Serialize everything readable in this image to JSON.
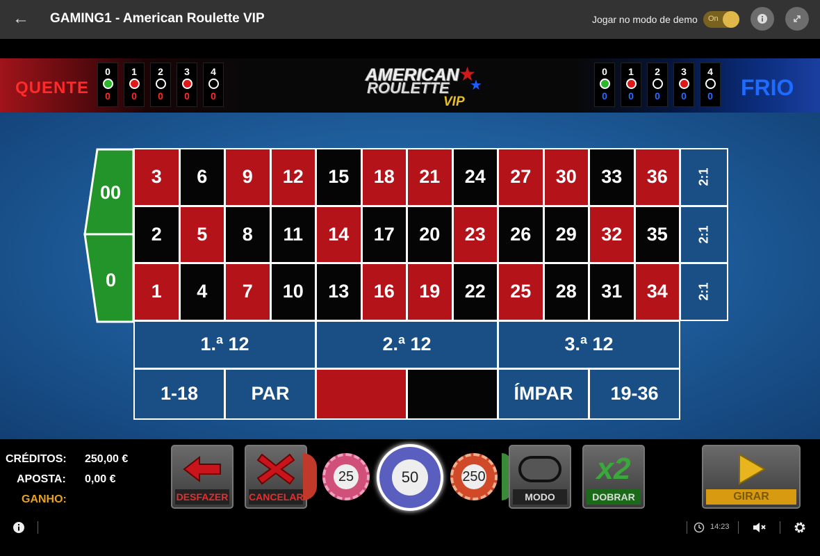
{
  "topbar": {
    "back_icon": "arrow-left-icon",
    "title": "GAMING1 - American Roulette VIP",
    "demo_label": "Jogar no modo de demo",
    "demo_toggle": "On",
    "info_icon": "info-icon",
    "fullscreen_icon": "expand-icon"
  },
  "banner": {
    "hot_label": "QUENTE",
    "cold_label": "FRIO",
    "hot_numbers": [
      {
        "num": "0",
        "color": "#2cb82c",
        "count": "0"
      },
      {
        "num": "1",
        "color": "#e01818",
        "count": "0"
      },
      {
        "num": "2",
        "color": "#000000",
        "count": "0"
      },
      {
        "num": "3",
        "color": "#e01818",
        "count": "0"
      },
      {
        "num": "4",
        "color": "#000000",
        "count": "0"
      }
    ],
    "cold_numbers": [
      {
        "num": "0",
        "color": "#2cb82c",
        "count": "0"
      },
      {
        "num": "1",
        "color": "#e01818",
        "count": "0"
      },
      {
        "num": "2",
        "color": "#000000",
        "count": "0"
      },
      {
        "num": "3",
        "color": "#e01818",
        "count": "0"
      },
      {
        "num": "4",
        "color": "#000000",
        "count": "0"
      }
    ],
    "logo": {
      "line1": "AMERICAN",
      "line2": "ROULETTE",
      "line3": "VIP"
    }
  },
  "table": {
    "zeros": [
      "00",
      "0"
    ],
    "rows": [
      [
        "3",
        "6",
        "9",
        "12",
        "15",
        "18",
        "21",
        "24",
        "27",
        "30",
        "33",
        "36"
      ],
      [
        "2",
        "5",
        "8",
        "11",
        "14",
        "17",
        "20",
        "23",
        "26",
        "29",
        "32",
        "35"
      ],
      [
        "1",
        "4",
        "7",
        "10",
        "13",
        "16",
        "19",
        "22",
        "25",
        "28",
        "31",
        "34"
      ]
    ],
    "red_numbers": [
      "1",
      "3",
      "5",
      "7",
      "9",
      "12",
      "14",
      "16",
      "18",
      "19",
      "21",
      "23",
      "25",
      "27",
      "30",
      "32",
      "34",
      "36"
    ],
    "columns": [
      "2:1",
      "2:1",
      "2:1"
    ],
    "dozens": [
      "1.ª 12",
      "2.ª 12",
      "3.ª 12"
    ],
    "outside": [
      "1-18",
      "PAR",
      "",
      "",
      "ÍMPAR",
      "19-36"
    ],
    "colors": {
      "red": "#b31319",
      "black": "#050505",
      "green": "#22942a",
      "felt": "#1f5f9e"
    }
  },
  "stats": {
    "credits_label": "CRÉDITOS:",
    "credits_value": "250,00 €",
    "bet_label": "APOSTA:",
    "bet_value": "0,00 €",
    "win_label": "GANHO:"
  },
  "controls": {
    "undo": "DESFAZER",
    "cancel": "CANCELAR",
    "mode": "MODO",
    "double": "DOBRAR",
    "double_icon_text": "x2",
    "spin": "GIRAR"
  },
  "chips": [
    "25",
    "50",
    "250"
  ],
  "statusbar": {
    "time": "14:23",
    "info_icon": "info-icon",
    "clock_icon": "clock-icon",
    "mute_icon": "speaker-muted-icon",
    "settings_icon": "gear-icon"
  }
}
